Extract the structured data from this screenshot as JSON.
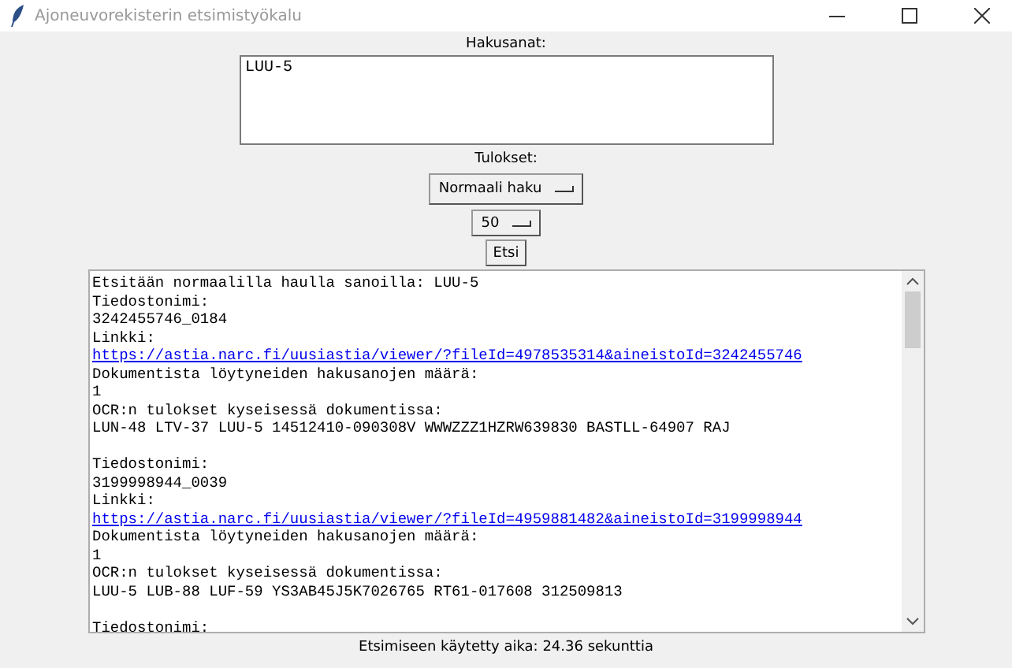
{
  "window": {
    "title": "Ajoneuvorekisterin etsimistyökalu"
  },
  "search_label": "Hakusanat:",
  "search_field": {
    "value": "LUU-5"
  },
  "results_label": "Tulokset:",
  "mode_menu": {
    "value": "Normaali haku"
  },
  "count_menu": {
    "value": "50"
  },
  "search_button": "Etsi",
  "results": [
    {
      "kind": "text",
      "text": "Etsitään normaalilla haulla sanoilla: LUU-5"
    },
    {
      "kind": "text",
      "text": "Tiedostonimi:"
    },
    {
      "kind": "text",
      "text": "3242455746_0184"
    },
    {
      "kind": "text",
      "text": "Linkki:"
    },
    {
      "kind": "link",
      "text": "https://astia.narc.fi/uusiastia/viewer/?fileId=4978535314&aineistoId=3242455746"
    },
    {
      "kind": "text",
      "text": "Dokumentista löytyneiden hakusanojen määrä:"
    },
    {
      "kind": "text",
      "text": "1"
    },
    {
      "kind": "text",
      "text": "OCR:n tulokset kyseisessä dokumentissa:"
    },
    {
      "kind": "text",
      "text": "LUN-48 LTV-37 LUU-5 14512410-090308V WWWZZZ1HZRW639830 BASTLL-64907 RAJ"
    },
    {
      "kind": "blank"
    },
    {
      "kind": "text",
      "text": "Tiedostonimi:"
    },
    {
      "kind": "text",
      "text": "3199998944_0039"
    },
    {
      "kind": "text",
      "text": "Linkki:"
    },
    {
      "kind": "link",
      "text": "https://astia.narc.fi/uusiastia/viewer/?fileId=4959881482&aineistoId=3199998944"
    },
    {
      "kind": "text",
      "text": "Dokumentista löytyneiden hakusanojen määrä:"
    },
    {
      "kind": "text",
      "text": "1"
    },
    {
      "kind": "text",
      "text": "OCR:n tulokset kyseisessä dokumentissa:"
    },
    {
      "kind": "text",
      "text": "LUU-5 LUB-88 LUF-59 YS3AB45J5K7026765 RT61-017608 312509813"
    },
    {
      "kind": "blank"
    },
    {
      "kind": "text",
      "text": "Tiedostonimi:"
    }
  ],
  "status": "Etsimiseen käytetty aika: 24.36 sekunttia"
}
